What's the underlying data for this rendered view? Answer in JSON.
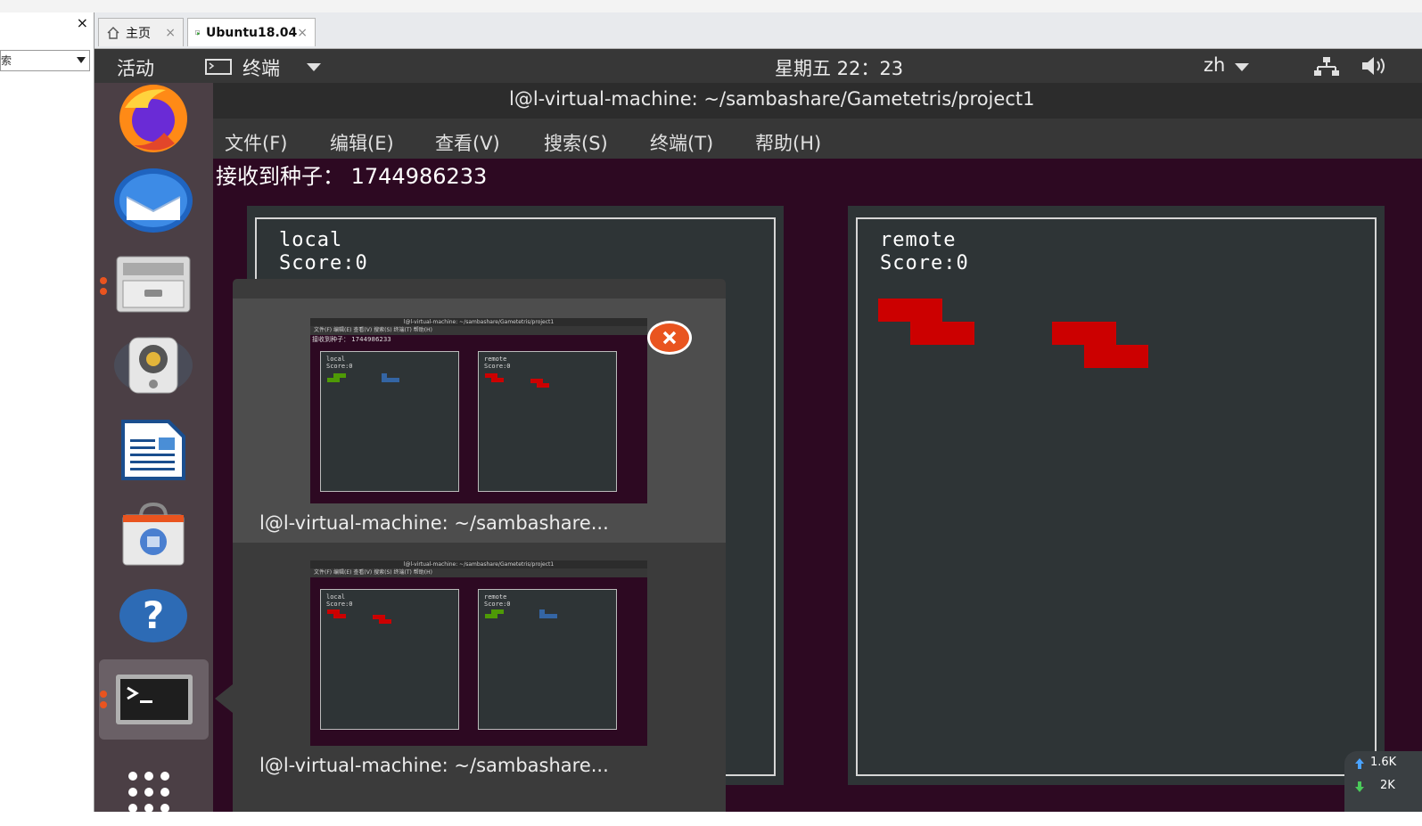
{
  "host": {
    "left_panel": {
      "close_label": "×",
      "search_text": "索"
    },
    "tabs": [
      {
        "label": "主页",
        "close": "×"
      },
      {
        "label": "Ubuntu18.04",
        "close": "×"
      }
    ]
  },
  "topbar": {
    "activities": "活动",
    "app_menu": "终端",
    "clock": "星期五 22：23",
    "input_method": "zh"
  },
  "terminal": {
    "title": "l@l-virtual-machine: ~/sambashare/Gametetris/project1",
    "menu": [
      "文件(F)",
      "编辑(E)",
      "查看(V)",
      "搜索(S)",
      "终端(T)",
      "帮助(H)"
    ],
    "seed_line": "接收到种子： 1744986233",
    "local": {
      "name": "local",
      "score_label": "Score:0"
    },
    "remote": {
      "name": "remote",
      "score_label": "Score:0"
    }
  },
  "switcher": {
    "items": [
      {
        "label": "l@l-virtual-machine: ~/sambashare...",
        "thumb_title": "l@l-virtual-machine: ~/sambashare/Gametetris/project1",
        "thumb_menu": "文件(F)  编辑(E)  查看(V)  搜索(S)  终端(T)  帮助(H)",
        "thumb_seed": "接收到种子： 1744986233",
        "boards": [
          "local\nScore:0",
          "remote\nScore:0"
        ]
      },
      {
        "label": "l@l-virtual-machine: ~/sambashare...",
        "thumb_title": "l@l-virtual-machine: ~/sambashare/Gametetris/project1",
        "thumb_menu": "文件(F)  编辑(E)  查看(V)  搜索(S)  终端(T)  帮助(H)",
        "thumb_seed": "",
        "boards": [
          "local\nScore:0",
          "remote\nScore:0"
        ]
      }
    ]
  },
  "netspeed": {
    "up": "1.6K",
    "down": "2K"
  },
  "colors": {
    "piece_red": "#cc0000",
    "piece_green": "#4e9a06",
    "piece_blue": "#3465a4",
    "terminal_bg": "#2d0922",
    "board_bg": "#2e3436",
    "ubuntu_orange": "#e9541f"
  }
}
